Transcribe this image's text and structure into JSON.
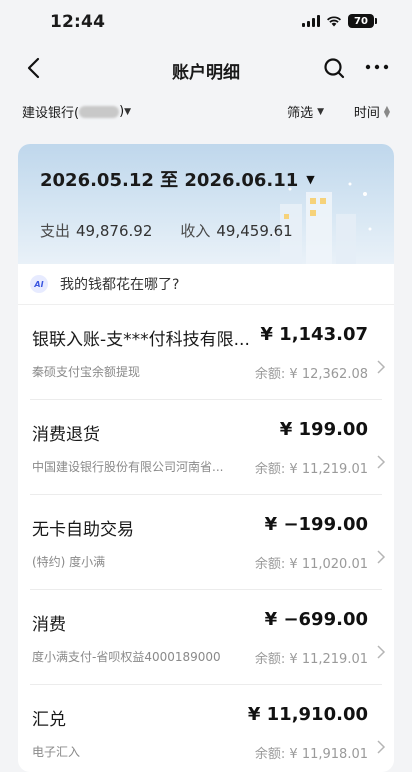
{
  "status_bar": {
    "time": "12:44",
    "battery": "70"
  },
  "nav": {
    "title": "账户明细"
  },
  "filters": {
    "account_prefix": "建设银行(",
    "account_suffix": ")",
    "filter_label": "筛选",
    "time_label": "时间"
  },
  "summary": {
    "date_range": "2026.05.12 至 2026.06.11",
    "expense_label": "支出",
    "expense_value": "49,876.92",
    "income_label": "收入",
    "income_value": "49,459.61"
  },
  "ai_prompt": {
    "badge": "AI",
    "text": "我的钱都花在哪了?"
  },
  "transactions": [
    {
      "title": "银联入账-支***付科技有限...",
      "amount": "¥ 1,143.07",
      "subtitle": "秦硕支付宝余额提现",
      "balance": "余额: ¥ 12,362.08"
    },
    {
      "title": "消费退货",
      "amount": "¥ 199.00",
      "subtitle": "中国建设银行股份有限公司河南省...",
      "balance": "余额: ¥ 11,219.01"
    },
    {
      "title": "无卡自助交易",
      "amount": "¥ −199.00",
      "subtitle": "(特约) 度小满",
      "balance": "余额: ¥ 11,020.01"
    },
    {
      "title": "消费",
      "amount": "¥ −699.00",
      "subtitle": "度小满支付-省呗权益4000189000",
      "balance": "余额: ¥ 11,219.01"
    },
    {
      "title": "汇兑",
      "amount": "¥ 11,910.00",
      "subtitle": "电子汇入",
      "balance": "余额: ¥ 11,918.01"
    }
  ]
}
